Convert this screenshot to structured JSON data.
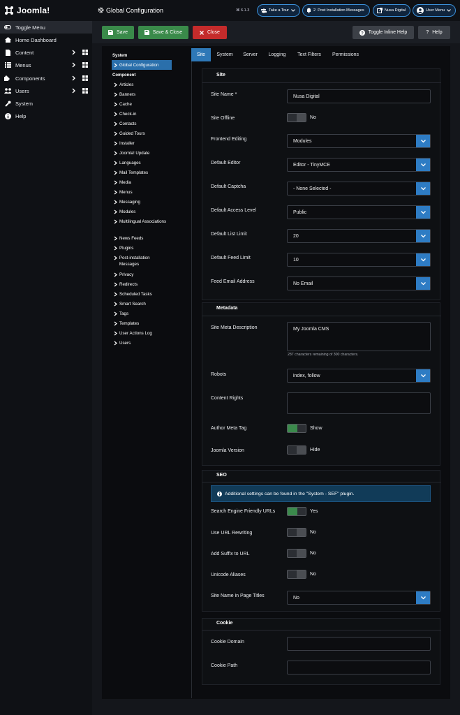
{
  "app": {
    "logo_text": "Joomla!",
    "page_title": "Global Configuration",
    "version": "⌘ 6.1.3"
  },
  "header_pills": {
    "tour": "Take a Tour",
    "messages_count": "2",
    "messages": "Post Installation Messages",
    "site": "Nusa Digital",
    "user": "User Menu"
  },
  "sidebar": {
    "items": [
      {
        "label": "Toggle Menu"
      },
      {
        "label": "Home Dashboard"
      },
      {
        "label": "Content"
      },
      {
        "label": "Menus"
      },
      {
        "label": "Components"
      },
      {
        "label": "Users"
      },
      {
        "label": "System"
      },
      {
        "label": "Help"
      }
    ]
  },
  "toolbar": {
    "save": "Save",
    "save_close": "Save & Close",
    "close": "Close",
    "toggle_help": "Toggle Inline Help",
    "help": "Help"
  },
  "left_nav": {
    "system_title": "System",
    "active_item": "Global Configuration",
    "component_title": "Component",
    "components": [
      "Articles",
      "Banners",
      "Cache",
      "Check-in",
      "Contacts",
      "Guided Tours",
      "Installer",
      "Joomla! Update",
      "Languages",
      "Mail Templates",
      "Media",
      "Menus",
      "Messaging",
      "Modules",
      "Multilingual Associations",
      "News Feeds",
      "Plugins",
      "Post-installation Messages",
      "Privacy",
      "Redirects",
      "Scheduled Tasks",
      "Smart Search",
      "Tags",
      "Templates",
      "User Actions Log",
      "Users"
    ]
  },
  "tabs": [
    "Site",
    "System",
    "Server",
    "Logging",
    "Text Filters",
    "Permissions"
  ],
  "site_section": {
    "title": "Site",
    "site_name_label": "Site Name *",
    "site_name_value": "Nusa Digital",
    "offline_label": "Site Offline",
    "offline_value": "No",
    "frontend_label": "Frontend Editing",
    "frontend_value": "Modules",
    "editor_label": "Default Editor",
    "editor_value": "Editor - TinyMCE",
    "captcha_label": "Default Captcha",
    "captcha_value": "- None Selected -",
    "access_label": "Default Access Level",
    "access_value": "Public",
    "list_label": "Default List Limit",
    "list_value": "20",
    "feed_label": "Default Feed Limit",
    "feed_value": "10",
    "email_label": "Feed Email Address",
    "email_value": "No Email"
  },
  "metadata_section": {
    "title": "Metadata",
    "desc_label": "Site Meta Description",
    "desc_value": "My Joomla CMS",
    "char_count": "287 characters remaining of 300 characters.",
    "robots_label": "Robots",
    "robots_value": "index, follow",
    "rights_label": "Content Rights",
    "author_label": "Author Meta Tag",
    "author_value": "Show",
    "version_label": "Joomla Version",
    "version_value": "Hide"
  },
  "seo_section": {
    "title": "SEO",
    "alert": "Additional settings can be found in the \"System - SEF\" plugin.",
    "sef_label": "Search Engine Friendly URLs",
    "sef_value": "Yes",
    "rewrite_label": "Use URL Rewriting",
    "rewrite_value": "No",
    "suffix_label": "Add Suffix to URL",
    "suffix_value": "No",
    "unicode_label": "Unicode Aliases",
    "unicode_value": "No",
    "sitename_label": "Site Name in Page Titles",
    "sitename_value": "No"
  },
  "cookie_section": {
    "title": "Cookie",
    "domain_label": "Cookie Domain",
    "path_label": "Cookie Path"
  },
  "colors": {
    "accent": "#2e78b7",
    "save": "#3a8a4a",
    "close": "#c42b2b"
  }
}
